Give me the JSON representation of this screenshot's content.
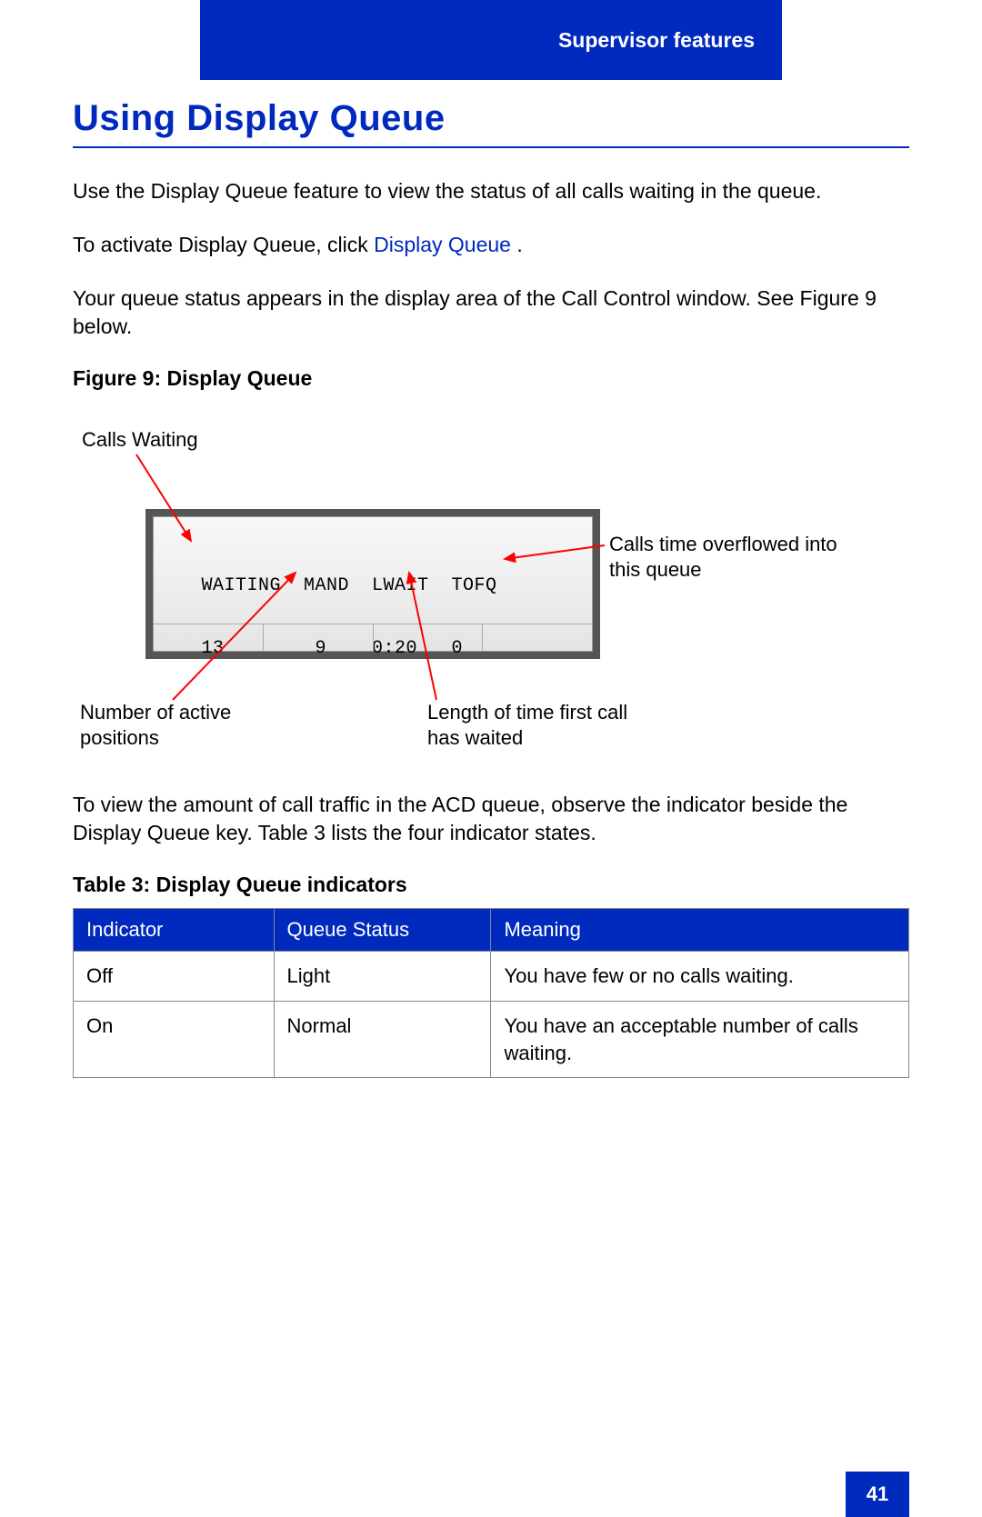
{
  "header": {
    "section": "Supervisor features"
  },
  "title": "Using Display Queue",
  "paragraphs": {
    "p1": "Use the Display Queue feature to view the status of all calls waiting in the queue.",
    "p2a": "To activate Display Queue, click ",
    "p2_link": "Display Queue",
    "p2b": " .",
    "p3": "Your queue status appears in the display area of the Call Control window. See Figure 9 below.",
    "p4": "To view the amount of call traffic in the ACD queue, observe the indicator beside the Display Queue key. Table 3 lists the four indicator states."
  },
  "figure": {
    "caption": "Figure 9: Display Queue",
    "lcd_line1": " WAITING  MAND  LWAIT  TOFQ",
    "lcd_line2": " 13        9    0:20   0",
    "callouts": {
      "calls_waiting": "Calls Waiting",
      "overflow": "Calls time overflowed into this queue",
      "active": "Number of active positions",
      "lwait": "Length of time first call has waited"
    }
  },
  "table": {
    "caption": "Table 3: Display Queue indicators",
    "headers": {
      "c1": "Indicator",
      "c2": "Queue Status",
      "c3": "Meaning"
    },
    "rows": [
      {
        "indicator": "Off",
        "status": "Light",
        "meaning": "You have few or no calls waiting."
      },
      {
        "indicator": "On",
        "status": "Normal",
        "meaning": "You have an acceptable number of calls waiting."
      }
    ]
  },
  "page_number": "41"
}
